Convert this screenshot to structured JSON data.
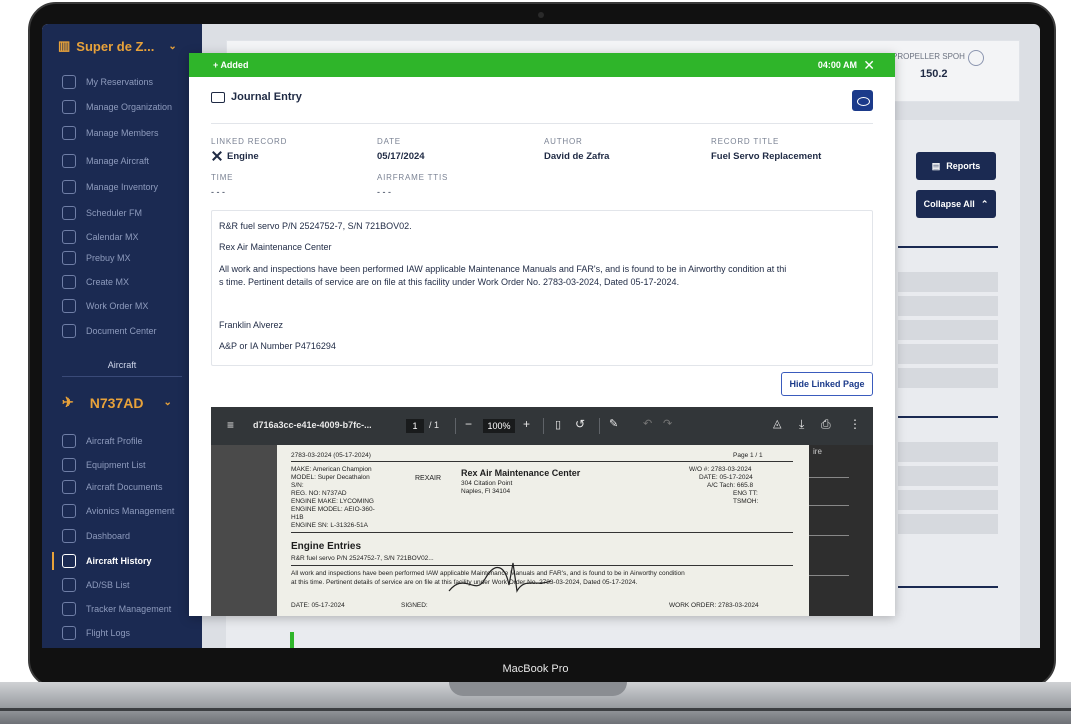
{
  "device": {
    "label": "MacBook Pro"
  },
  "sidebar": {
    "org_name": "Super de Z...",
    "items": [
      {
        "label": "My Reservations"
      },
      {
        "label": "Manage Organization"
      },
      {
        "label": "Manage Members"
      },
      {
        "label": "Manage Aircraft"
      },
      {
        "label": "Manage Inventory"
      },
      {
        "label": "Scheduler FM"
      },
      {
        "label": "Calendar MX"
      },
      {
        "label": "Prebuy MX"
      },
      {
        "label": "Create MX"
      },
      {
        "label": "Work Order MX"
      },
      {
        "label": "Document Center"
      }
    ],
    "section_label": "Aircraft",
    "aircraft_tail": "N737AD",
    "aircraft_items": [
      {
        "label": "Aircraft Profile"
      },
      {
        "label": "Equipment List"
      },
      {
        "label": "Aircraft Documents"
      },
      {
        "label": "Avionics Management"
      },
      {
        "label": "Dashboard"
      },
      {
        "label": "Aircraft History"
      },
      {
        "label": "AD/SB List"
      },
      {
        "label": "Tracker Management"
      },
      {
        "label": "Flight Logs"
      }
    ],
    "active_item": "Aircraft History"
  },
  "background": {
    "propeller_label": "PROPELLER SPOH",
    "propeller_value": "150.2",
    "reports_label": "Reports",
    "collapse_label": "Collapse All"
  },
  "toast": {
    "label": "Added",
    "time": "04:00 AM"
  },
  "modal": {
    "title": "Journal Entry",
    "fields": {
      "linked_record_label": "LINKED RECORD",
      "linked_record_value": "Engine",
      "date_label": "DATE",
      "date_value": "05/17/2024",
      "author_label": "AUTHOR",
      "author_value": "David de Zafra",
      "record_title_label": "RECORD TITLE",
      "record_title_value": "Fuel Servo Replacement",
      "time_label": "TIME",
      "time_value": "- - -",
      "airframe_label": "AIRFRAME TTIS",
      "airframe_value": "- - -"
    },
    "entry": {
      "line1": "R&R fuel servo P/N 2524752-7, S/N 721BOV02.",
      "line2": "Rex Air Maintenance Center",
      "line3": "All work and inspections have been performed IAW applicable Maintenance Manuals and FAR's, and is found to be in Airworthy condition at thi",
      "line4": "s time. Pertinent details of service are on file at this facility under Work Order No. 2783-03-2024, Dated 05-17-2024.",
      "line5": "Franklin Alverez",
      "line6": "A&P or IA Number P4716294"
    },
    "hide_button": "Hide Linked Page"
  },
  "pdf": {
    "filename": "d716a3cc-e41e-4009-b7fc-...",
    "page_current": "1",
    "page_total": "/ 1",
    "zoom": "100%",
    "doc": {
      "date_hdr": "2783-03-2024 (05-17-2024)",
      "page": "Page 1 / 1",
      "make": "MAKE: American Champion",
      "model": "MODEL: Super Decathalon",
      "sn": "S/N:",
      "reg": "REG. NO: N737AD",
      "eng_make": "ENGINE MAKE: LYCOMING",
      "eng_model": "ENGINE MODEL: AEIO-360-",
      "h1b": "H1B",
      "eng_sn": "ENGINE SN: L-31326-51A",
      "logo": "REXAIR",
      "center_name": "Rex Air Maintenance Center",
      "addr1": "304 Citation Point",
      "addr2": "Naples, Fl 34104",
      "wo": "W/O #: 2783-03-2024",
      "date": "DATE: 05-17-2024",
      "tach": "A/C Tach: 665.8",
      "eng_tt": "ENG TT:",
      "tsmoh": "TSMOH:",
      "section": "Engine Entries",
      "entry1": "R&R fuel servo P/N 2524752-7, S/N 721BOV02...",
      "entry2": "All work and inspections have been performed IAW applicable Maintenance Manuals and FAR's, and is found to be in Airworthy condition",
      "entry3": "at this time. Pertinent details of service are on file at this facility under Work Order No. 2783-03-2024, Dated 05-17-2024.",
      "footer_date": "DATE: 05-17-2024",
      "signed": "SIGNED:",
      "work_order": "WORK ORDER: 2783-03-2024",
      "side_text": "ire"
    }
  },
  "colors": {
    "sidebar_bg": "#1b2a52",
    "accent": "#e8a23a",
    "success": "#2fb52a",
    "primary": "#1b3a8a"
  }
}
